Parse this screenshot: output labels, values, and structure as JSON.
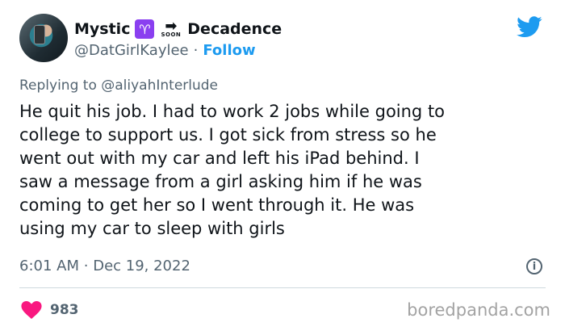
{
  "author": {
    "name_part1": "Mystic",
    "aries_symbol": "♈",
    "soon_label": "SOON",
    "name_part2": "Decadence",
    "handle": "@DatGirlKaylee",
    "separator": "·",
    "follow_label": "Follow"
  },
  "reply": {
    "prefix": "Replying to",
    "mention": "@aliyahInterlude"
  },
  "tweet": {
    "lines": [
      "He quit his job. I had to work 2 jobs while going to",
      "college to support us. I got sick from stress so he",
      "went out with my car and left his iPad behind. I",
      "saw a message from a girl asking him if he was",
      "coming to get her so I went through it. He was",
      "using my car to sleep with girls"
    ],
    "time": "6:01 AM",
    "separator": "·",
    "date": "Dec 19, 2022"
  },
  "engagement": {
    "likes": "983"
  },
  "watermark": "boredpanda.com",
  "icons": [
    "twitter-bird-icon",
    "info-icon",
    "heart-icon",
    "aries-icon",
    "soon-arrow-icon"
  ],
  "colors": {
    "accent": "#1d9bf0",
    "heart": "#f91880",
    "aries_bg": "#8a3ff0",
    "muted": "#536471"
  }
}
